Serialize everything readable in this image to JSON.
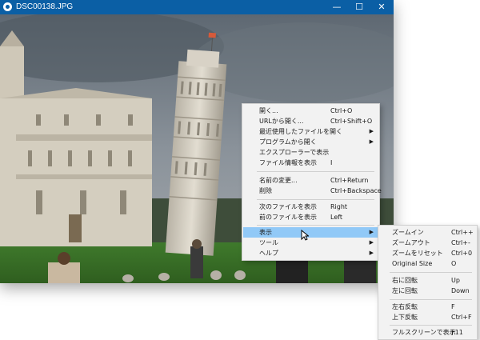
{
  "window": {
    "title": "DSC00138.JPG",
    "controls": {
      "minimize": "—",
      "maximize": "☐",
      "close": "✕"
    }
  },
  "context_menu": {
    "items": [
      {
        "label": "開く...",
        "shortcut": "Ctrl+O"
      },
      {
        "label": "URLから開く...",
        "shortcut": "Ctrl+Shift+O"
      },
      {
        "label": "最近使用したファイルを開く",
        "submenu": true
      },
      {
        "label": "プログラムから開く",
        "submenu": true
      },
      {
        "label": "エクスプローラーで表示"
      },
      {
        "label": "ファイル情報を表示",
        "shortcut": "I"
      },
      {
        "label": "名前の変更...",
        "shortcut": "Ctrl+Return"
      },
      {
        "label": "削除",
        "shortcut": "Ctrl+Backspace"
      },
      {
        "label": "次のファイルを表示",
        "shortcut": "Right"
      },
      {
        "label": "前のファイルを表示",
        "shortcut": "Left"
      },
      {
        "label": "表示",
        "submenu": true,
        "highlighted": true
      },
      {
        "label": "ツール",
        "submenu": true
      },
      {
        "label": "ヘルプ",
        "submenu": true
      }
    ]
  },
  "view_submenu": {
    "items": [
      {
        "label": "ズームイン",
        "shortcut": "Ctrl++"
      },
      {
        "label": "ズームアウト",
        "shortcut": "Ctrl+-"
      },
      {
        "label": "ズームをリセット",
        "shortcut": "Ctrl+0"
      },
      {
        "label": "Original Size",
        "shortcut": "O"
      },
      {
        "label": "右に回転",
        "shortcut": "Up"
      },
      {
        "label": "左に回転",
        "shortcut": "Down"
      },
      {
        "label": "左右反転",
        "shortcut": "F"
      },
      {
        "label": "上下反転",
        "shortcut": "Ctrl+F"
      },
      {
        "label": "フルスクリーンで表示",
        "shortcut": "F11"
      }
    ]
  },
  "colors": {
    "titlebar": "#0b5fa5",
    "menu_bg": "#f2f2f2",
    "highlight": "#91c9f7"
  }
}
